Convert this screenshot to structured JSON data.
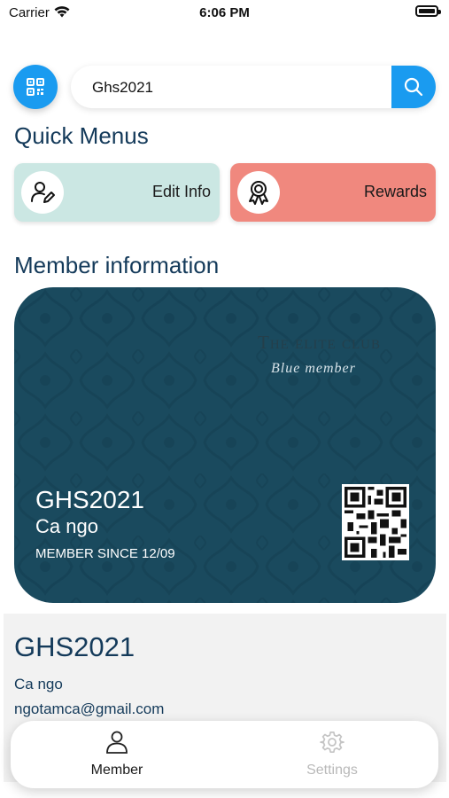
{
  "status_bar": {
    "carrier": "Carrier",
    "time": "6:06 PM",
    "battery_level": 1.0
  },
  "search": {
    "value": "Ghs2021",
    "placeholder": ""
  },
  "quick_menus": {
    "title": "Quick Menus",
    "items": [
      {
        "label": "Edit Info",
        "icon": "edit-user-icon",
        "color": "#cbe7e3"
      },
      {
        "label": "Rewards",
        "icon": "award-ribbon-icon",
        "color": "#f0887e"
      }
    ]
  },
  "member_information": {
    "title": "Member information",
    "card": {
      "club_title": "The elite club",
      "tier": "Blue member",
      "code": "GHS2021",
      "name": "Ca ngo",
      "member_since": "MEMBER SINCE  12/09",
      "color": "#1a4a5e"
    },
    "details": {
      "code": "GHS2021",
      "name": "Ca ngo",
      "email": "ngotamca@gmail.com"
    }
  },
  "tab_bar": {
    "tabs": [
      {
        "label": "Member",
        "icon": "user-icon",
        "active": true
      },
      {
        "label": "Settings",
        "icon": "gear-icon",
        "active": false
      }
    ]
  },
  "colors": {
    "accent": "#1a9bf0",
    "heading": "#143a5a"
  }
}
